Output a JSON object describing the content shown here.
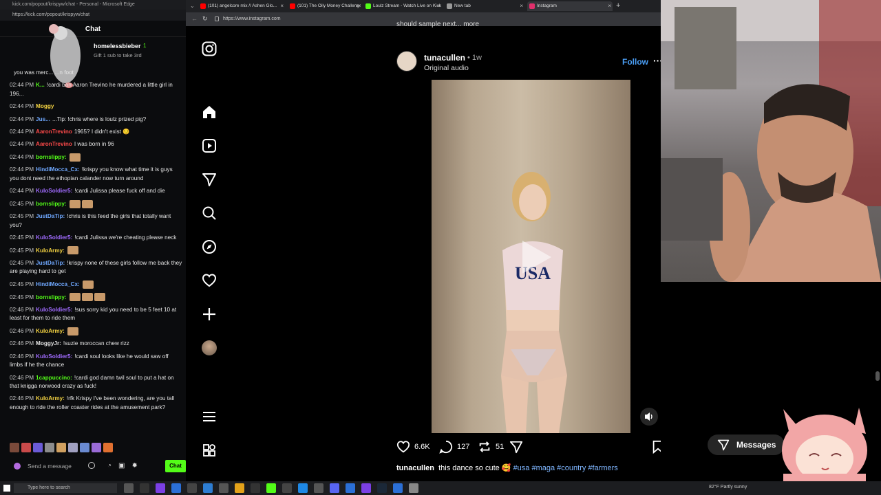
{
  "chat_window": {
    "title": "kick.com/popout/krispyw/chat - Personal - Microsoft Edge",
    "url": "https://kick.com/popout/krispyw/chat",
    "header": "Chat",
    "pinned": {
      "user": "homelessbieber",
      "sub_text": "Gift 1 sub to take 3rd",
      "badge": "1"
    },
    "messages": [
      {
        "time": "",
        "user": "",
        "text": "you was merc... ...n foot",
        "color": "#e7e7e7"
      },
      {
        "time": "02:44 PM",
        "user": "K...",
        "text": "!cardi ban Aaron Trevino he murdered a little girl in 196...",
        "color": "#53fc18"
      },
      {
        "time": "02:44 PM",
        "user": "Moggy",
        "text": "",
        "color": "#f5d442"
      },
      {
        "time": "02:44 PM",
        "user": "Jus...",
        "text": "...Tip: !chris where is loulz prized pig?",
        "color": "#6fa8ff"
      },
      {
        "time": "02:44 PM",
        "user": "AaronTrevino",
        "text": "1965? I didn't exist 😏",
        "color": "#ff4a4a"
      },
      {
        "time": "02:44 PM",
        "user": "AaronTrevino",
        "text": "I was born in 96",
        "color": "#ff4a4a"
      },
      {
        "time": "02:44 PM",
        "user": "bornslippy:",
        "text": "",
        "color": "#53fc18",
        "emotes": 1
      },
      {
        "time": "02:44 PM",
        "user": "HindiMocca_Cx:",
        "text": "!krispy you know what time it is guys you dont need the ethopian calander now turn around",
        "color": "#6fa8ff"
      },
      {
        "time": "02:44 PM",
        "user": "KuloSoldier5:",
        "text": "!cardi Julissa please fuck off and die",
        "color": "#a06bff"
      },
      {
        "time": "02:45 PM",
        "user": "bornslippy:",
        "text": "",
        "color": "#53fc18",
        "emotes": 2
      },
      {
        "time": "02:45 PM",
        "user": "JustDaTip:",
        "text": "!chris is this feed the girls that totally want you?",
        "color": "#6fa8ff"
      },
      {
        "time": "02:45 PM",
        "user": "KuloSoldier5:",
        "text": "!cardi Julissa we're cheating please neck",
        "color": "#a06bff"
      },
      {
        "time": "02:45 PM",
        "user": "KuloArmy:",
        "text": "",
        "color": "#f5d442",
        "emotes": 1
      },
      {
        "time": "02:45 PM",
        "user": "JustDaTip:",
        "text": "!krispy none of these girls follow me back they are playing hard to get",
        "color": "#6fa8ff"
      },
      {
        "time": "02:45 PM",
        "user": "HindiMocca_Cx:",
        "text": "",
        "color": "#6fa8ff",
        "emotes": 1
      },
      {
        "time": "02:45 PM",
        "user": "bornslippy:",
        "text": "",
        "color": "#53fc18",
        "emotes": 3
      },
      {
        "time": "02:46 PM",
        "user": "KuloSoldier5:",
        "text": "!sus sorry kid you need to be 5 feet 10 at least for them to ride them",
        "color": "#a06bff"
      },
      {
        "time": "02:46 PM",
        "user": "KuloArmy:",
        "text": "",
        "color": "#f5d442",
        "emotes": 1
      },
      {
        "time": "02:46 PM",
        "user": "MoggyJr:",
        "text": "!suzie moroccan chew rizz",
        "color": "#e7e7e7"
      },
      {
        "time": "02:46 PM",
        "user": "KuloSoldier5:",
        "text": "!cardi soul looks like he would saw off limbs if he the chance",
        "color": "#a06bff"
      },
      {
        "time": "02:46 PM",
        "user": "1cappuccino:",
        "text": "!cardi god damn twil soul to put a hat on that knigga norwood crazy as fuck!",
        "color": "#53fc18"
      },
      {
        "time": "02:46 PM",
        "user": "KuloArmy:",
        "text": "!rfk Krispy I've been wondering, are you tall enough to ride the roller coaster rides at the amusement park?",
        "color": "#f5d442"
      }
    ],
    "input_placeholder": "Send a message",
    "chat_button": "Chat"
  },
  "browser": {
    "tabs": [
      {
        "label": "(101) angelcore mix // Ashen Glo...",
        "active": false,
        "icon_color": "#ff0000"
      },
      {
        "label": "(101) The Oily Money Challenge",
        "active": false,
        "icon_color": "#ff0000"
      },
      {
        "label": "Loulz Stream - Watch Live on Kick",
        "active": false,
        "icon_color": "#53fc18"
      },
      {
        "label": "New tab",
        "active": false,
        "icon_color": "#999999"
      },
      {
        "label": "Instagram",
        "active": true,
        "icon_color": "#e1306c"
      }
    ],
    "url": "https://www.instagram.com"
  },
  "instagram": {
    "caption_top": "should sample next...  more",
    "post": {
      "username": "tunacullen",
      "time": "• 1w",
      "audio": "Original audio",
      "follow": "Follow",
      "likes": "6.6K",
      "comments": "127",
      "reposts": "51",
      "caption_user": "tunacullen",
      "caption_text": "this dance so cute 🥰",
      "hashtags": "#usa #maga #country #farmers",
      "shirt_text": "USA"
    },
    "messages_button": "Messages"
  },
  "taskbar": {
    "search_placeholder": "Type here to search",
    "weather": "82°F  Partly sunny"
  },
  "colors": {
    "kick_green": "#53fc18",
    "follow_blue": "#4a9ef5",
    "hashtag": "#7fb6ff"
  }
}
